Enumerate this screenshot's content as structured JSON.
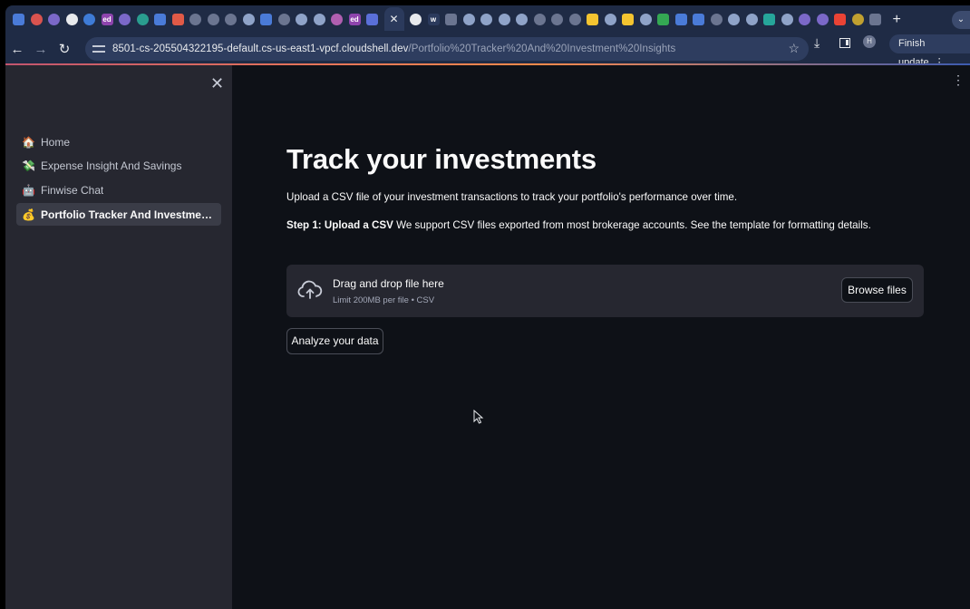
{
  "browser": {
    "url_host": "8501-cs-205504322195-default.cs-us-east1-vpcf.cloudshell.dev",
    "url_path": "/Portfolio%20Tracker%20And%20Investment%20Insights",
    "finish_update_label": "Finish update",
    "profile_initial": "H",
    "tab_badges": [
      "ed",
      "ed"
    ]
  },
  "sidebar": {
    "items": [
      {
        "icon": "🏠",
        "label": "Home",
        "active": false
      },
      {
        "icon": "💸",
        "label": "Expense Insight And Savings",
        "active": false
      },
      {
        "icon": "🤖",
        "label": "Finwise Chat",
        "active": false
      },
      {
        "icon": "💰",
        "label": "Portfolio Tracker And Investment In...",
        "active": true
      }
    ]
  },
  "main": {
    "title": "Track your investments",
    "intro": "Upload a CSV file of your investment transactions to track your portfolio's performance over time.",
    "step_label": "Step 1: Upload a CSV",
    "step_text": " We support CSV files exported from most brokerage accounts. See the template for formatting details.",
    "dropzone": {
      "title": "Drag and drop file here",
      "subtitle": "Limit 200MB per file • CSV",
      "browse_label": "Browse files"
    },
    "analyze_label": "Analyze your data"
  },
  "colors": {
    "main_bg": "#0e1117",
    "sidebar_bg": "#262730",
    "chrome_bg": "#1f2b45"
  }
}
